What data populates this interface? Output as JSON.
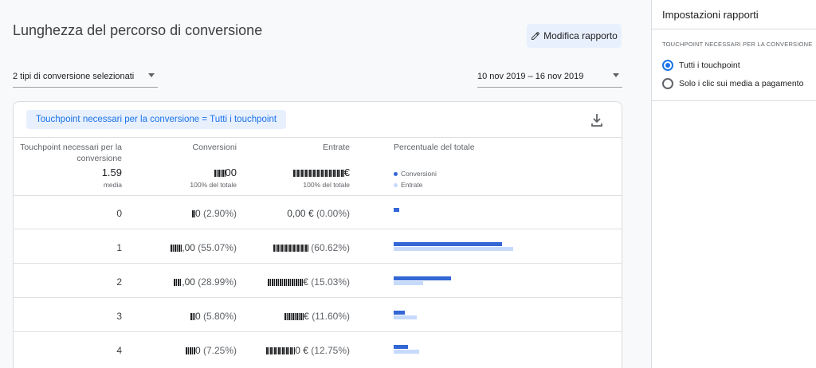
{
  "header": {
    "title": "Lunghezza del percorso di conversione",
    "edit_button": "Modifica rapporto"
  },
  "filters": {
    "conversion_types": "2 tipi di conversione selezionati",
    "date_range": "10 nov 2019 – 16 nov 2019"
  },
  "card": {
    "chip": "Touchpoint necessari per la conversione = Tutti i touchpoint",
    "columns": {
      "touchpoints": "Touchpoint necessari per la conversione",
      "conversions": "Conversioni",
      "revenue": "Entrate",
      "percent": "Percentuale del totale"
    },
    "summary": {
      "touchpoints_value": "1.59",
      "touchpoints_sub": "media",
      "conversions_value": "00",
      "conversions_sub": "100% del totale",
      "revenue_value": "€",
      "revenue_sub": "100% del totale"
    },
    "legend": {
      "conversions": "Conversioni",
      "revenue": "Entrate",
      "conversions_color": "#3367d6",
      "revenue_color": "#c6dafc"
    },
    "rows": [
      {
        "touchpoints": "0",
        "conv_value": "0",
        "conv_pct": "(2.90%)",
        "rev_value": "0,00 €",
        "rev_pct": "(0.00%)",
        "conv_share": 0.029,
        "rev_share": 0.0
      },
      {
        "touchpoints": "1",
        "conv_value": ",00",
        "conv_pct": "(55.07%)",
        "rev_value": "",
        "rev_pct": "(60.62%)",
        "conv_share": 0.5507,
        "rev_share": 0.6062
      },
      {
        "touchpoints": "2",
        "conv_value": ",00",
        "conv_pct": "(28.99%)",
        "rev_value": "€",
        "rev_pct": "(15.03%)",
        "conv_share": 0.2899,
        "rev_share": 0.1503
      },
      {
        "touchpoints": "3",
        "conv_value": "0",
        "conv_pct": "(5.80%)",
        "rev_value": "€",
        "rev_pct": "(11.60%)",
        "conv_share": 0.058,
        "rev_share": 0.116
      },
      {
        "touchpoints": "4",
        "conv_value": "0",
        "conv_pct": "(7.25%)",
        "rev_value": "0 €",
        "rev_pct": "(12.75%)",
        "conv_share": 0.0725,
        "rev_share": 0.1275
      }
    ]
  },
  "panel": {
    "title": "Impostazioni rapporti",
    "section": "TOUCHPOINT NECESSARI PER LA CONVERSIONE",
    "options": [
      {
        "label": "Tutti i touchpoint",
        "selected": true
      },
      {
        "label": "Solo i clic sui media a pagamento",
        "selected": false
      }
    ]
  }
}
